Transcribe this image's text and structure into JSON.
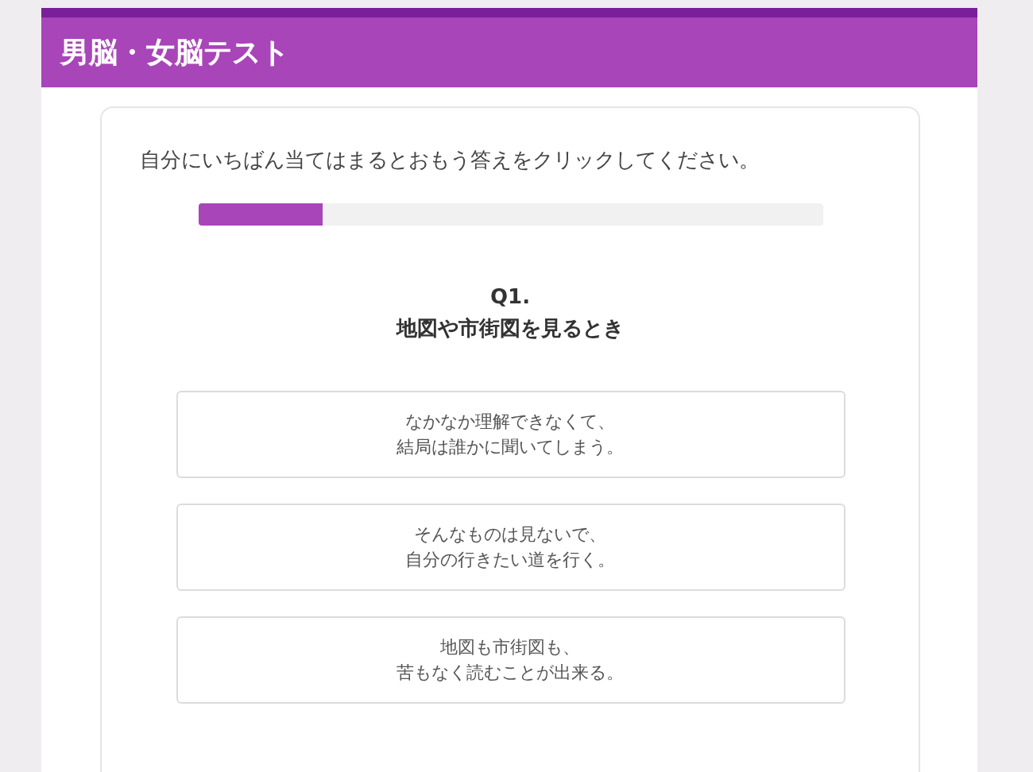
{
  "header": {
    "title": "男脳・女脳テスト"
  },
  "instruction": "自分にいちばん当てはまるとおもう答えをクリックしてください。",
  "progress": {
    "level": 0.2
  },
  "question": {
    "number": "Q1.",
    "text": "地図や市街図を見るとき"
  },
  "answers": [
    {
      "lines": [
        "なかなか理解できなくて、",
        "結局は誰かに聞いてしまう。"
      ]
    },
    {
      "lines": [
        "そんなものは見ないで、",
        "自分の行きたい道を行く。"
      ]
    },
    {
      "lines": [
        "地図も市街図も、",
        "苦もなく読むことが出来る。"
      ]
    }
  ]
}
